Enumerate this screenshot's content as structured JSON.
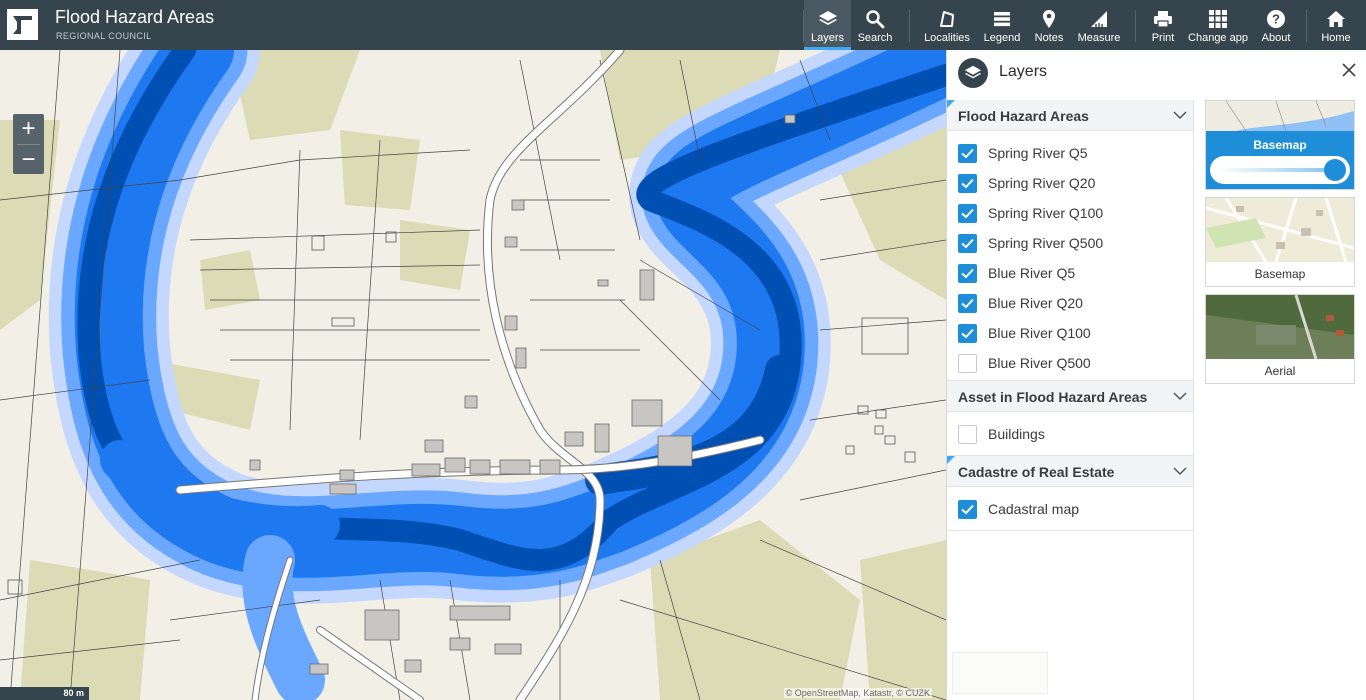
{
  "app": {
    "title": "Flood Hazard Areas",
    "subtitle": "REGIONAL COUNCIL"
  },
  "toolbar": [
    {
      "id": "layers",
      "label": "Layers",
      "icon": "layers-icon",
      "active": true
    },
    {
      "id": "search",
      "label": "Search",
      "icon": "search-icon"
    },
    {
      "id": "localities",
      "label": "Localities",
      "icon": "localities-icon"
    },
    {
      "id": "legend",
      "label": "Legend",
      "icon": "legend-icon"
    },
    {
      "id": "notes",
      "label": "Notes",
      "icon": "pin-icon"
    },
    {
      "id": "measure",
      "label": "Measure",
      "icon": "ruler-icon"
    },
    {
      "id": "print",
      "label": "Print",
      "icon": "printer-icon"
    },
    {
      "id": "change_app",
      "label": "Change app",
      "icon": "grid-icon"
    },
    {
      "id": "about",
      "label": "About",
      "icon": "help-icon"
    },
    {
      "id": "home",
      "label": "Home",
      "icon": "home-icon"
    }
  ],
  "map": {
    "zoom_in": "+",
    "zoom_out": "−",
    "scale_label": "80 m",
    "attribution": "© OpenStreetMap, Katastr, © CUZK"
  },
  "panel": {
    "title": "Layers",
    "groups": [
      {
        "title": "Flood Hazard Areas",
        "items": [
          {
            "label": "Spring River Q5",
            "checked": true
          },
          {
            "label": "Spring River Q20",
            "checked": true
          },
          {
            "label": "Spring River Q100",
            "checked": true
          },
          {
            "label": "Spring River Q500",
            "checked": true
          },
          {
            "label": "Blue River Q5",
            "checked": true
          },
          {
            "label": "Blue River Q20",
            "checked": true
          },
          {
            "label": "Blue River Q100",
            "checked": true
          },
          {
            "label": "Blue River Q500",
            "checked": false
          }
        ]
      },
      {
        "title": "Asset in Flood Hazard Areas",
        "items": [
          {
            "label": "Buildings",
            "checked": false
          }
        ]
      },
      {
        "title": "Cadastre of Real Estate",
        "items": [
          {
            "label": "Cadastral map",
            "checked": true
          }
        ]
      }
    ],
    "basemaps": [
      {
        "label": "Basemap",
        "active": true
      },
      {
        "label": "Basemap",
        "active": false
      },
      {
        "label": "Aerial",
        "active": false
      }
    ]
  },
  "colors": {
    "header": "#36454d",
    "accent": "#1f8ed8",
    "flood_q5": "#0050b4",
    "flood_q20": "#1e78f0",
    "flood_q100": "#6aa8ff",
    "flood_q500": "#c4d8ff",
    "land": "#f2efe6",
    "vegetation": "#dbdcb6"
  }
}
